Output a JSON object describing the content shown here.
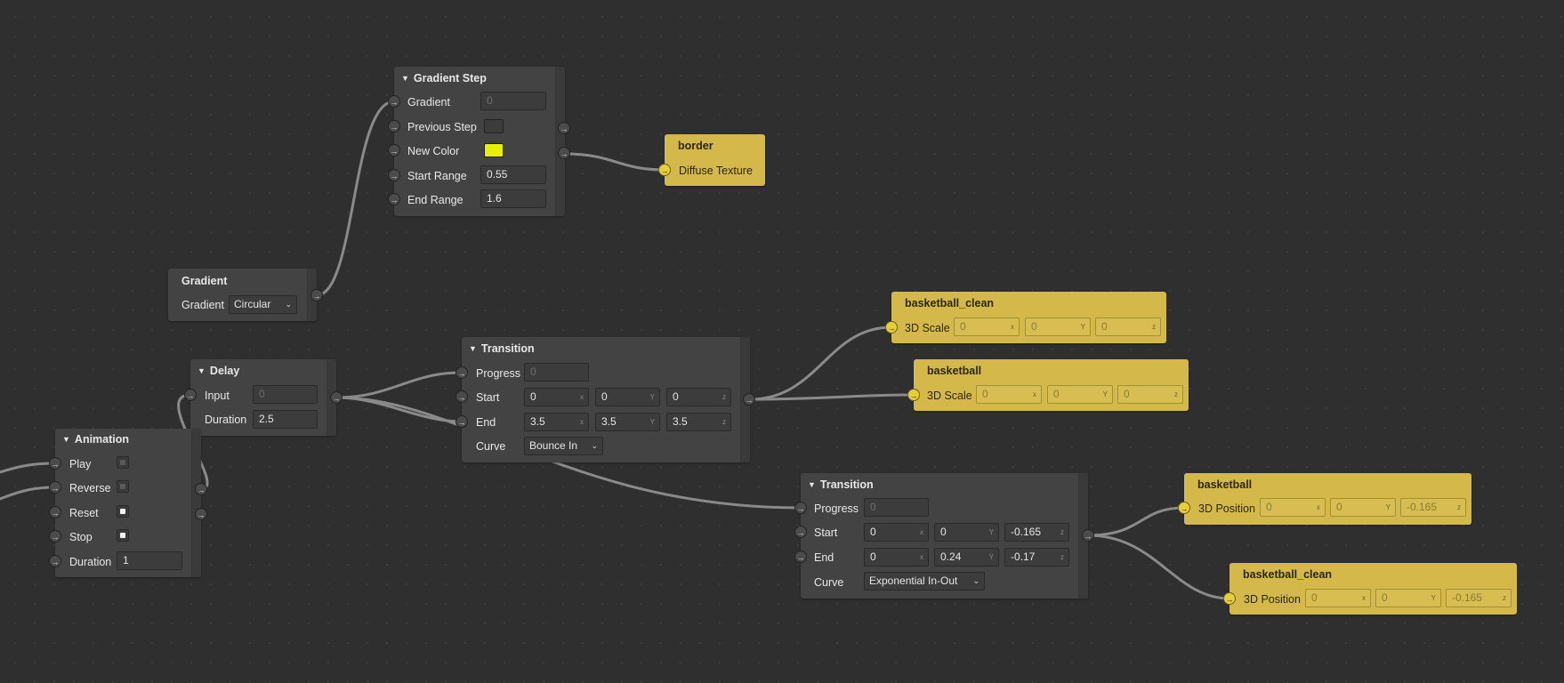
{
  "colors": {
    "canvas": "#2f2f2f",
    "node": "#434343",
    "target_node": "#d4b84a",
    "wire": "#8a8a8a",
    "new_color_swatch": "#e6f000"
  },
  "icons": {
    "port": "arrow-right-icon",
    "collapse": "triangle-down-icon",
    "dropdown": "chevron-down-icon"
  },
  "gradient_step": {
    "title": "Gradient Step",
    "gradient_label": "Gradient",
    "gradient_value": "0",
    "previous_step_label": "Previous Step",
    "new_color_label": "New Color",
    "start_range_label": "Start Range",
    "start_range_value": "0.55",
    "end_range_label": "End Range",
    "end_range_value": "1.6"
  },
  "border_node": {
    "title": "border",
    "port_label": "Diffuse Texture"
  },
  "gradient": {
    "title": "Gradient",
    "label": "Gradient",
    "selected": "Circular"
  },
  "delay": {
    "title": "Delay",
    "input_label": "Input",
    "input_value": "0",
    "duration_label": "Duration",
    "duration_value": "2.5"
  },
  "animation": {
    "title": "Animation",
    "play_label": "Play",
    "reverse_label": "Reverse",
    "reset_label": "Reset",
    "stop_label": "Stop",
    "duration_label": "Duration",
    "duration_value": "1"
  },
  "transition1": {
    "title": "Transition",
    "progress_label": "Progress",
    "progress_value": "0",
    "start_label": "Start",
    "start": [
      "0",
      "0",
      "0"
    ],
    "end_label": "End",
    "end": [
      "3.5",
      "3.5",
      "3.5"
    ],
    "curve_label": "Curve",
    "curve": "Bounce In"
  },
  "transition2": {
    "title": "Transition",
    "progress_label": "Progress",
    "progress_value": "0",
    "start_label": "Start",
    "start": [
      "0",
      "0",
      "-0.165"
    ],
    "end_label": "End",
    "end": [
      "0",
      "0.24",
      "-0.17"
    ],
    "curve_label": "Curve",
    "curve": "Exponential In-Out"
  },
  "axes": [
    "x",
    "Y",
    "z"
  ],
  "bb_clean_scale": {
    "title": "basketball_clean",
    "port_label": "3D Scale",
    "values": [
      "0",
      "0",
      "0"
    ]
  },
  "bb_scale": {
    "title": "basketball",
    "port_label": "3D Scale",
    "values": [
      "0",
      "0",
      "0"
    ]
  },
  "bb_position": {
    "title": "basketball",
    "port_label": "3D Position",
    "values": [
      "0",
      "0",
      "-0.165"
    ]
  },
  "bb_clean_position": {
    "title": "basketball_clean",
    "port_label": "3D Position",
    "values": [
      "0",
      "0",
      "-0.165"
    ]
  }
}
